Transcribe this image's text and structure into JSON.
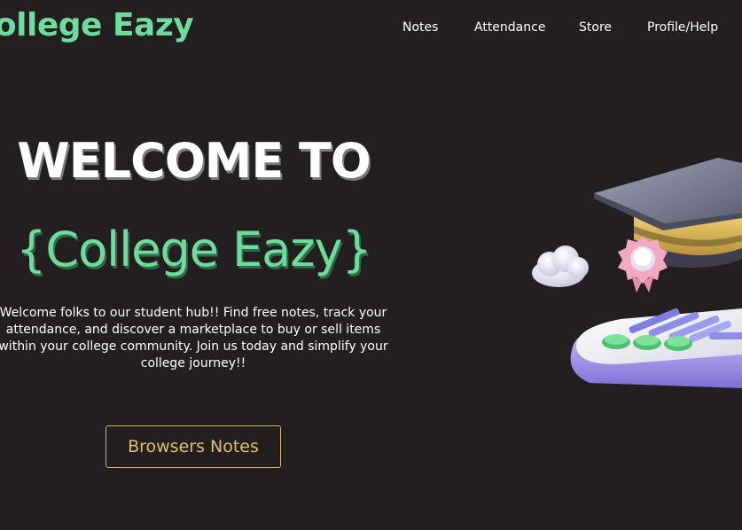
{
  "header": {
    "logo_text": "College Eazy",
    "nav": [
      {
        "label": "Notes"
      },
      {
        "label": "Attendance"
      },
      {
        "label": "Store"
      },
      {
        "label": "Profile/Help"
      }
    ]
  },
  "hero": {
    "title": "WELCOME TO",
    "brand": "{College Eazy}",
    "description": "Welcome folks to our student hub!! Find free notes, track your attendance, and discover a marketplace to buy or sell items within your college community. Join us today and simplify your college journey!!",
    "cta_label": "Browsers Notes"
  },
  "colors": {
    "background": "#231f21",
    "accent_green": "#6fdb9c",
    "button_gold": "#d7b45a",
    "text": "#ffffff"
  },
  "icons": {
    "illustration": "graduation-cap-keyboard-illustration"
  }
}
